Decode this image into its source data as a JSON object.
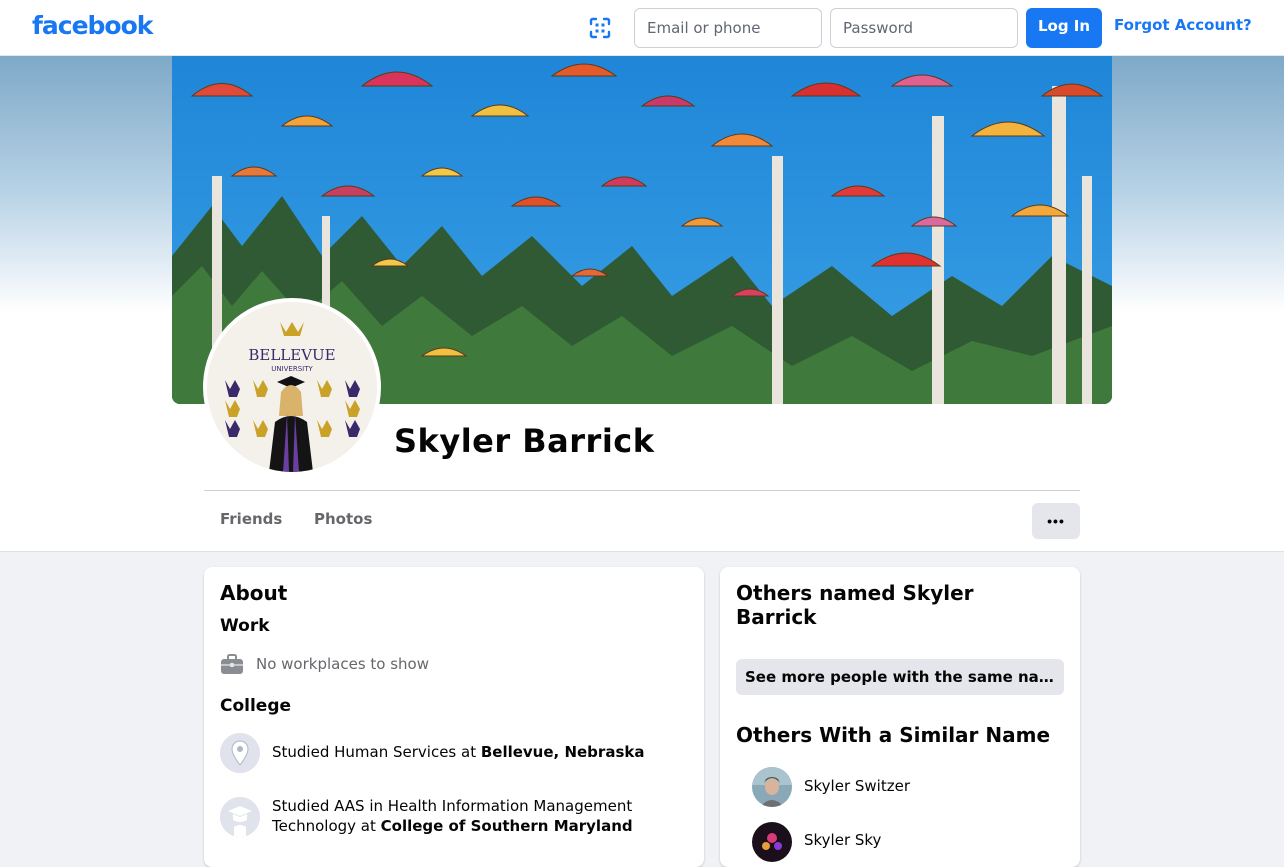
{
  "topbar": {
    "logo": "facebook",
    "email_placeholder": "Email or phone",
    "password_placeholder": "Password",
    "login_label": "Log In",
    "forgot_label": "Forgot Account?"
  },
  "profile": {
    "name": "Skyler Barrick",
    "avatar_text_1": "BELLEVUE",
    "avatar_text_2": "UNIVERSITY"
  },
  "tabs": [
    {
      "label": "Friends"
    },
    {
      "label": "Photos"
    }
  ],
  "more_button": "•••",
  "about": {
    "title": "About",
    "work": {
      "heading": "Work",
      "text": "No workplaces to show"
    },
    "college": {
      "heading": "College",
      "items": [
        {
          "prefix": "Studied Human Services at ",
          "place": "Bellevue, Nebraska"
        },
        {
          "prefix_line1": "Studied AAS in Health Information Management",
          "prefix_line2": "Technology at ",
          "place": "College of Southern Maryland"
        }
      ]
    }
  },
  "others": {
    "title_line1": "Others named Skyler",
    "title_line2": "Barrick",
    "see_more": "See more people with the same name",
    "similar_title": "Others With a Similar Name",
    "people": [
      {
        "name": "Skyler Switzer"
      },
      {
        "name": "Skyler Sky"
      }
    ]
  },
  "colors": {
    "brand": "#1877f2",
    "page_bg": "#f0f2f5",
    "button_gray": "#e4e6eb"
  }
}
